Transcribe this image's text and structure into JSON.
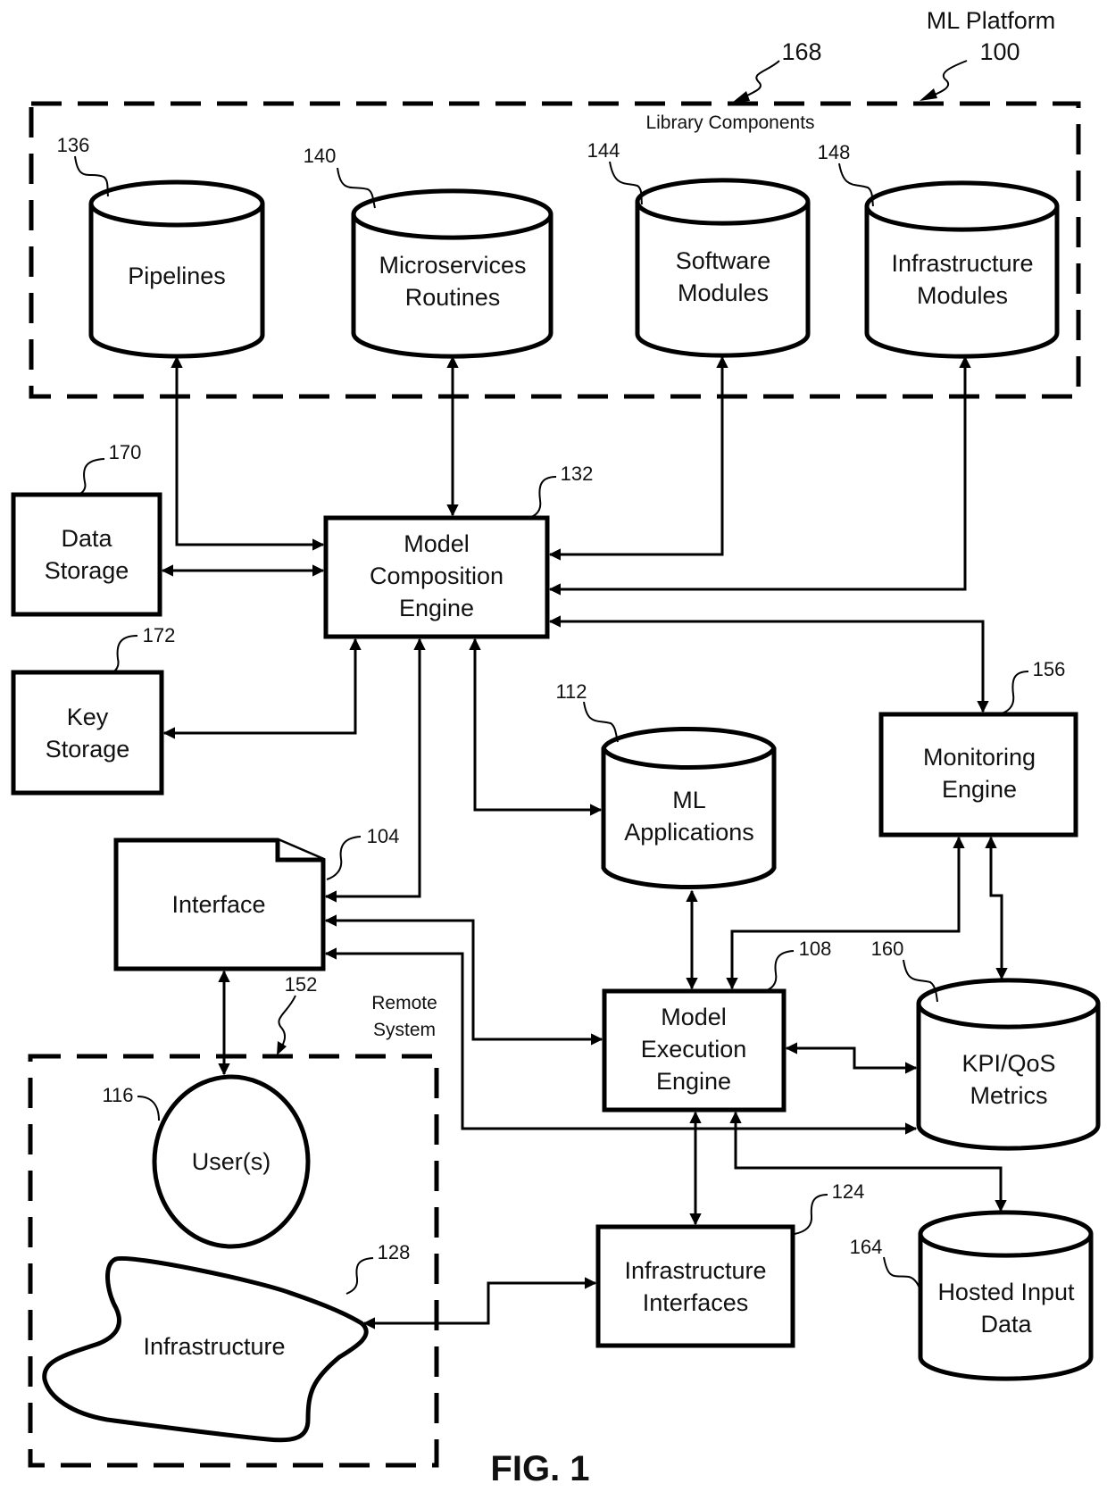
{
  "figure": {
    "caption": "FIG. 1",
    "platform": {
      "title": "ML Platform",
      "ref": "100"
    },
    "library": {
      "title": "Library Components",
      "ref": "168"
    },
    "remote": {
      "title_line1": "Remote",
      "title_line2": "System",
      "ref": "152"
    }
  },
  "nodes": {
    "pipelines": {
      "ref": "136",
      "lines": [
        "Pipelines"
      ]
    },
    "microservices": {
      "ref": "140",
      "lines": [
        "Microservices",
        "Routines"
      ]
    },
    "software_modules": {
      "ref": "144",
      "lines": [
        "Software",
        "Modules"
      ]
    },
    "infrastructure_modules": {
      "ref": "148",
      "lines": [
        "Infrastructure",
        "Modules"
      ]
    },
    "data_storage": {
      "ref": "170",
      "lines": [
        "Data",
        "Storage"
      ]
    },
    "key_storage": {
      "ref": "172",
      "lines": [
        "Key",
        "Storage"
      ]
    },
    "model_composition": {
      "ref": "132",
      "lines": [
        "Model",
        "Composition",
        "Engine"
      ]
    },
    "ml_applications": {
      "ref": "112",
      "lines": [
        "ML",
        "Applications"
      ]
    },
    "monitoring": {
      "ref": "156",
      "lines": [
        "Monitoring",
        "Engine"
      ]
    },
    "interface": {
      "ref": "104",
      "lines": [
        "Interface"
      ]
    },
    "model_execution": {
      "ref": "108",
      "lines": [
        "Model",
        "Execution",
        "Engine"
      ]
    },
    "kpi_metrics": {
      "ref": "160",
      "lines": [
        "KPI/QoS",
        "Metrics"
      ]
    },
    "users": {
      "ref": "116",
      "lines": [
        "User(s)"
      ]
    },
    "infrastructure_interfaces": {
      "ref": "124",
      "lines": [
        "Infrastructure",
        "Interfaces"
      ]
    },
    "hosted_input": {
      "ref": "164",
      "lines": [
        "Hosted Input",
        "Data"
      ]
    },
    "infrastructure": {
      "ref": "128",
      "lines": [
        "Infrastructure"
      ]
    }
  }
}
